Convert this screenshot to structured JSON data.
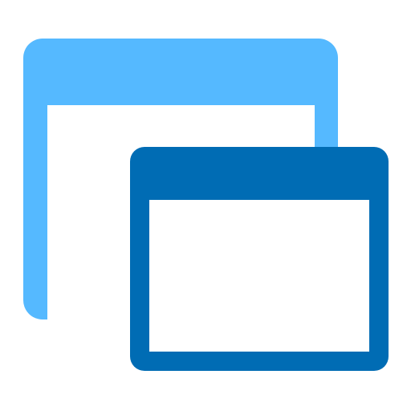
{
  "icon": {
    "name": "multiple-windows-icon",
    "back_window_color": "#55B9FF",
    "front_window_color": "#006CB4",
    "content_color": "#FFFFFF"
  }
}
